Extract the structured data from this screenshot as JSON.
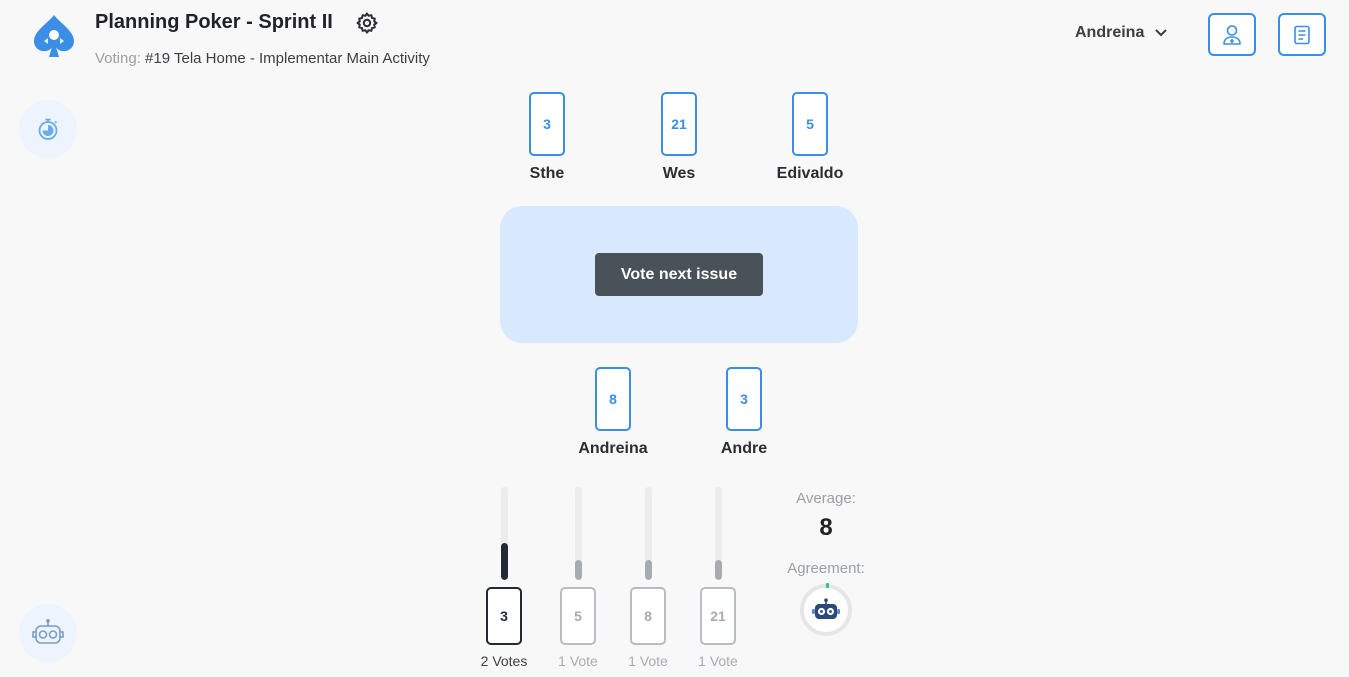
{
  "app": {
    "title": "Planning Poker - Sprint II",
    "voting_prefix": "Voting:",
    "voting_issue": "#19 Tela Home - Implementar Main Activity"
  },
  "user": {
    "name": "Andreina"
  },
  "colors": {
    "accent": "#3a8ee6",
    "table": "#d8e8fd",
    "dark": "#4a5259"
  },
  "players_top": [
    {
      "name": "Sthe",
      "card": "3"
    },
    {
      "name": "Wes",
      "card": "21"
    },
    {
      "name": "Edivaldo",
      "card": "5"
    }
  ],
  "players_bottom": [
    {
      "name": "Andreina",
      "card": "8"
    },
    {
      "name": "Andre",
      "card": "3"
    }
  ],
  "table": {
    "button_label": "Vote next issue"
  },
  "results": [
    {
      "card": "3",
      "votes_label": "2 Votes",
      "votes": 2
    },
    {
      "card": "5",
      "votes_label": "1 Vote",
      "votes": 1
    },
    {
      "card": "8",
      "votes_label": "1 Vote",
      "votes": 1
    },
    {
      "card": "21",
      "votes_label": "1 Vote",
      "votes": 1
    }
  ],
  "stats": {
    "average_label": "Average:",
    "average_value": "8",
    "agreement_label": "Agreement:"
  },
  "icons": {
    "logo": "spade-rocket-logo",
    "settings": "gear-icon",
    "dropdown": "chevron-down-icon",
    "invite": "add-user-icon",
    "issues": "document-list-icon",
    "timer": "stopwatch-icon",
    "bot": "robot-icon"
  }
}
